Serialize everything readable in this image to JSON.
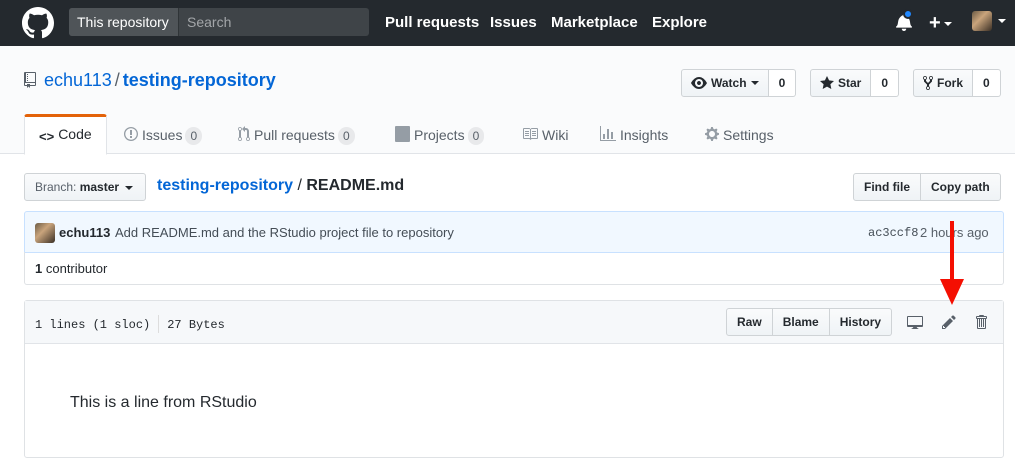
{
  "header": {
    "search_scope": "This repository",
    "search_placeholder": "Search",
    "nav": [
      "Pull requests",
      "Issues",
      "Marketplace",
      "Explore"
    ]
  },
  "repo": {
    "owner": "echu113",
    "separator": "/",
    "name": "testing-repository",
    "watch_label": "Watch",
    "watch_count": "0",
    "star_label": "Star",
    "star_count": "0",
    "fork_label": "Fork",
    "fork_count": "0"
  },
  "tabs": {
    "code": "Code",
    "issues": "Issues",
    "issues_count": "0",
    "pulls": "Pull requests",
    "pulls_count": "0",
    "projects": "Projects",
    "projects_count": "0",
    "wiki": "Wiki",
    "insights": "Insights",
    "settings": "Settings"
  },
  "filenav": {
    "branch_prefix": "Branch:",
    "branch": "master",
    "breadcrumb_repo": "testing-repository",
    "breadcrumb_sep": "/",
    "file_name": "README.md",
    "find_file": "Find file",
    "copy_path": "Copy path"
  },
  "commit": {
    "author": "echu113",
    "message": "Add README.md and the RStudio project file to repository",
    "sha": "ac3ccf8",
    "time": "2 hours ago",
    "contributors_count": "1",
    "contributors_label": "contributor"
  },
  "file": {
    "lines": "1 lines (1 sloc)",
    "size": "27 Bytes",
    "raw": "Raw",
    "blame": "Blame",
    "history": "History",
    "content": "This is a line from RStudio"
  },
  "colors": {
    "header_bg": "#24292e",
    "link": "#0366d6",
    "tab_accent": "#e36209",
    "annotation_arrow": "#f40f02"
  },
  "icons": [
    "github-logo-icon",
    "bell-icon",
    "plus-icon",
    "eye-icon",
    "star-icon",
    "fork-icon",
    "code-icon",
    "issue-icon",
    "pull-request-icon",
    "project-icon",
    "book-icon",
    "graph-icon",
    "gear-icon",
    "desktop-icon",
    "pencil-icon",
    "trash-icon",
    "repo-icon"
  ]
}
